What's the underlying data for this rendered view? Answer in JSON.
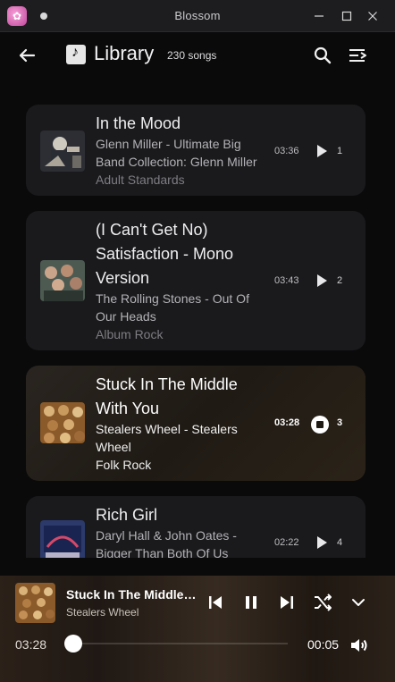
{
  "window": {
    "title": "Blossom"
  },
  "header": {
    "title": "Library",
    "count": "230 songs"
  },
  "songs": [
    {
      "title": "In the Mood",
      "artist": "Glenn Miller - Ultimate Big Band Collection: Glenn Miller",
      "genre": "Adult Standards",
      "duration": "03:36",
      "number": "1",
      "state": "play"
    },
    {
      "title": "(I Can't Get No) Satisfaction - Mono Version",
      "artist": "The Rolling Stones - Out Of Our Heads",
      "genre": "Album Rock",
      "duration": "03:43",
      "number": "2",
      "state": "play"
    },
    {
      "title": "Stuck In The Middle With You",
      "artist": "Stealers Wheel - Stealers Wheel",
      "genre": "Folk Rock",
      "duration": "03:28",
      "number": "3",
      "state": "stop"
    },
    {
      "title": "Rich Girl",
      "artist": "Daryl Hall & John Oates - Bigger Than Both Of Us",
      "genre": "",
      "duration": "02:22",
      "number": "4",
      "state": "play"
    }
  ],
  "player": {
    "title": "Stuck In The Middle ...",
    "artist": "Stealers Wheel",
    "elapsed": "03:28",
    "remaining": "00:05",
    "progress": 0.0
  },
  "icons": {
    "back": "arrow-left-icon",
    "library": "music-library-icon",
    "search": "search-icon",
    "queue": "queue-icon",
    "prev": "skip-previous-icon",
    "pause": "pause-icon",
    "next": "skip-next-icon",
    "shuffle": "shuffle-icon",
    "collapse": "chevron-down-icon",
    "volume": "volume-icon"
  },
  "colors": {
    "accent": "#ffffff",
    "card": "#1a1a1d",
    "background": "#0a0a0b"
  }
}
